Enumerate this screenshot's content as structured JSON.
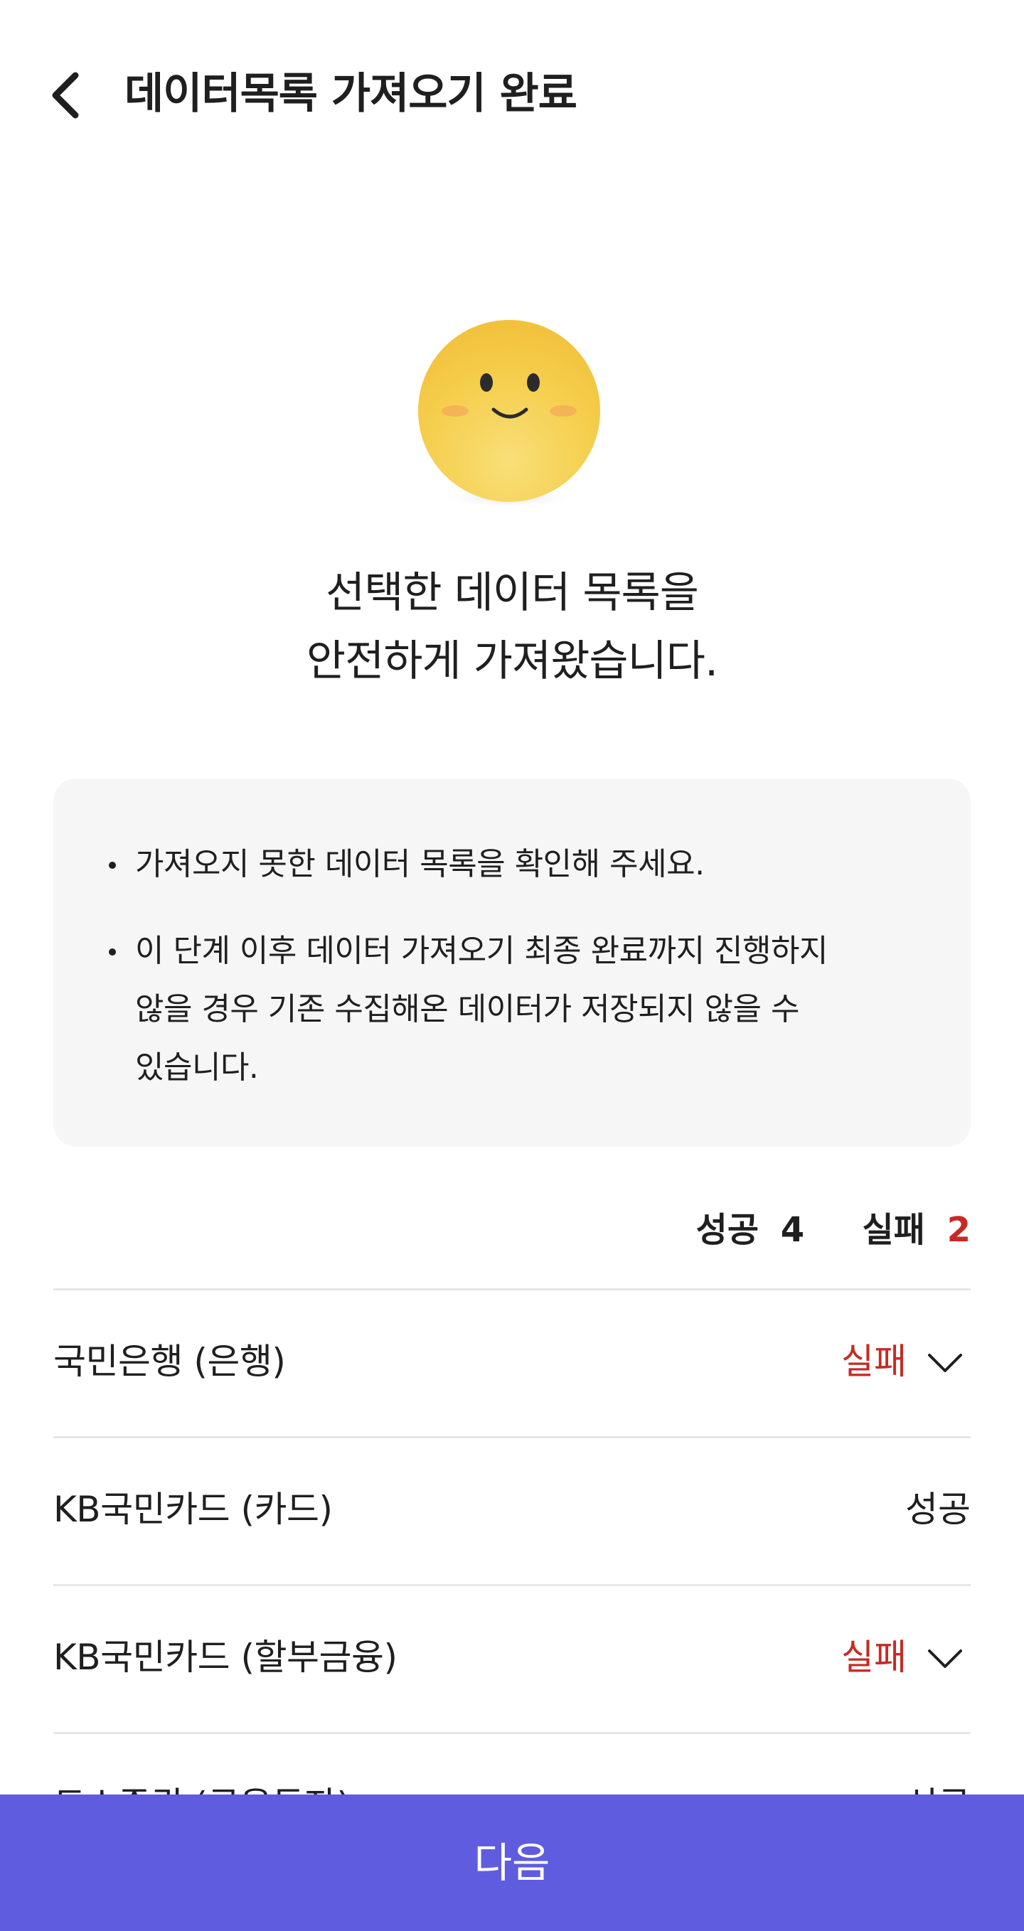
{
  "header": {
    "title": "데이터목록 가져오기 완료",
    "back_icon": "chevron-left-icon"
  },
  "illustration": {
    "icon": "smiling-face-emoji"
  },
  "message": {
    "line1": "선택한 데이터 목록을",
    "line2": "안전하게 가져왔습니다."
  },
  "notices": [
    {
      "lines": [
        "가져오지 못한 데이터 목록을 확인해 주세요."
      ]
    },
    {
      "lines": [
        "이 단계 이후 데이터 가져오기 최종 완료까지 진행하지",
        "않을 경우 기존 수집해온 데이터가 저장되지 않을 수",
        "있습니다."
      ]
    }
  ],
  "summary": {
    "success_label": "성공",
    "success_count": "4",
    "fail_label": "실패",
    "fail_count": "2"
  },
  "results": [
    {
      "name": "국민은행 (은행)",
      "status": "실패",
      "expandable": true
    },
    {
      "name": "KB국민카드 (카드)",
      "status": "성공",
      "expandable": false
    },
    {
      "name": "KB국민카드 (할부금융)",
      "status": "실패",
      "expandable": true
    },
    {
      "name": "토스증권 (금융투자)",
      "status": "성공",
      "expandable": false
    }
  ],
  "colors": {
    "primary": "#5f5ce0",
    "fail": "#c52b25",
    "text": "#1f1f1f",
    "notice_bg": "#f6f6f6"
  },
  "footer": {
    "next_label": "다음"
  }
}
